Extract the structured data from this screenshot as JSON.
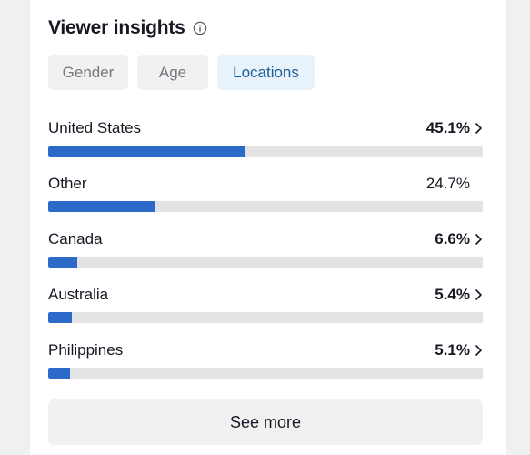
{
  "header": {
    "title": "Viewer insights",
    "info_icon": "info-circle-icon"
  },
  "tabs": [
    {
      "label": "Gender",
      "active": false
    },
    {
      "label": "Age",
      "active": false
    },
    {
      "label": "Locations",
      "active": true
    }
  ],
  "locations": [
    {
      "name": "United States",
      "percent": "45.1%",
      "share": 0.451,
      "chevron": true
    },
    {
      "name": "Other",
      "percent": "24.7%",
      "share": 0.247,
      "chevron": false
    },
    {
      "name": "Canada",
      "percent": "6.6%",
      "share": 0.066,
      "chevron": true
    },
    {
      "name": "Australia",
      "percent": "5.4%",
      "share": 0.054,
      "chevron": true
    },
    {
      "name": "Philippines",
      "percent": "5.1%",
      "share": 0.051,
      "chevron": true
    }
  ],
  "footer": {
    "see_more_label": "See more"
  },
  "colors": {
    "bar_fill": "#2c6ac9",
    "bar_track": "#e3e3e5",
    "active_tab_bg": "#e8f2fb",
    "active_tab_text": "#1d5e96"
  }
}
